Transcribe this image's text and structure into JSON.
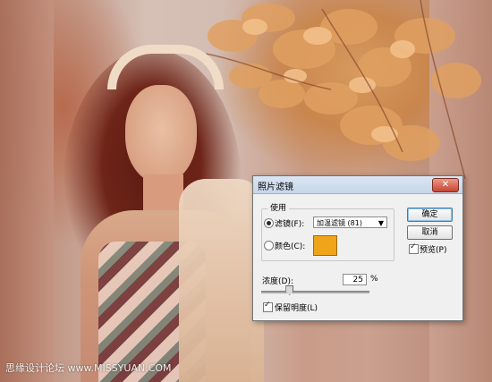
{
  "dialog": {
    "title": "照片滤镜",
    "close_label": "✕",
    "group_label": "使用",
    "filter_radio_label": "滤镜(F):",
    "filter_selected": "加温滤镜 (81)",
    "color_radio_label": "颜色(C):",
    "swatch_color": "#f0a41a",
    "density_label": "浓度(D):",
    "density_value": "25",
    "density_unit": "%",
    "density_level_percent": 25,
    "preserve_label": "保留明度(L)",
    "ok_label": "确定",
    "cancel_label": "取消",
    "preview_label": "预览(P)",
    "filter_checked": true,
    "color_checked": false,
    "preview_checked": true,
    "preserve_checked": true
  },
  "watermark": {
    "text": "思缘设计论坛 www.MISSYUAN.COM"
  }
}
